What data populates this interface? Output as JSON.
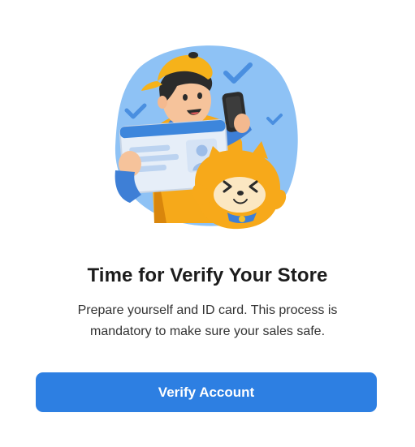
{
  "illustration": {
    "icon": "store-verification-illustration",
    "colors": {
      "blob": "#8ec2f5",
      "cap": "#f6b21a",
      "jacket": "#f6a91a",
      "shirt": "#3e7fd6",
      "card": "#e6eef8",
      "card_header": "#3d86dc",
      "mascot": "#f7a91a",
      "check": "#4a8fe0"
    }
  },
  "title": "Time for Verify Your Store",
  "description": {
    "line1": "Prepare yourself and ID card. This process is",
    "line2": "mandatory to make sure your sales safe."
  },
  "button": {
    "label": "Verify Account",
    "color": "#2d7fe2"
  }
}
